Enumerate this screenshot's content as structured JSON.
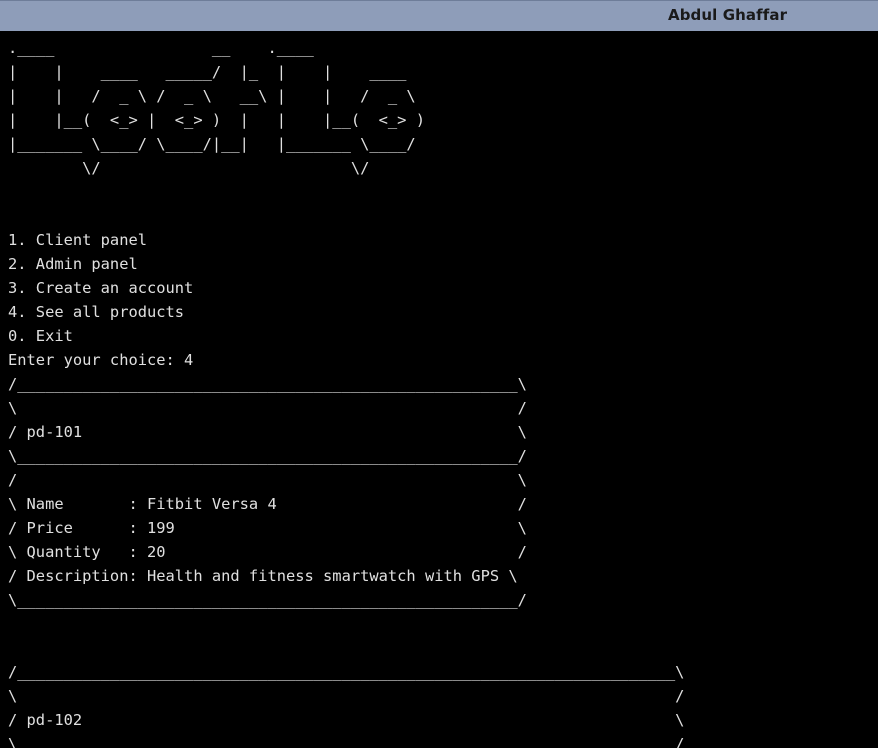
{
  "window": {
    "user_name": "Abdul Ghaffar"
  },
  "terminal": {
    "lines": [
      ".____                 __    .____",
      "|    |    ____   _____/  |_  |    |    ____",
      "|    |   /  _ \\ /  _ \\   __\\ |    |   /  _ \\",
      "|    |__(  <_> |  <_> )  |   |    |__(  <_> )",
      "|_______ \\____/ \\____/|__|   |_______ \\____/",
      "        \\/                           \\/",
      "",
      "",
      "1. Client panel",
      "2. Admin panel",
      "3. Create an account",
      "4. See all products",
      "0. Exit",
      "Enter your choice: 4",
      "/______________________________________________________\\",
      "\\                                                      /",
      "/ pd-101                                               \\",
      "\\______________________________________________________/",
      "/                                                      \\",
      "\\ Name       : Fitbit Versa 4                          /",
      "/ Price      : 199                                     \\",
      "\\ Quantity   : 20                                      /",
      "/ Description: Health and fitness smartwatch with GPS \\",
      "\\______________________________________________________/",
      "",
      "",
      "/_______________________________________________________________________\\",
      "\\                                                                       /",
      "/ pd-102                                                                \\",
      "\\                                                                       /"
    ]
  }
}
